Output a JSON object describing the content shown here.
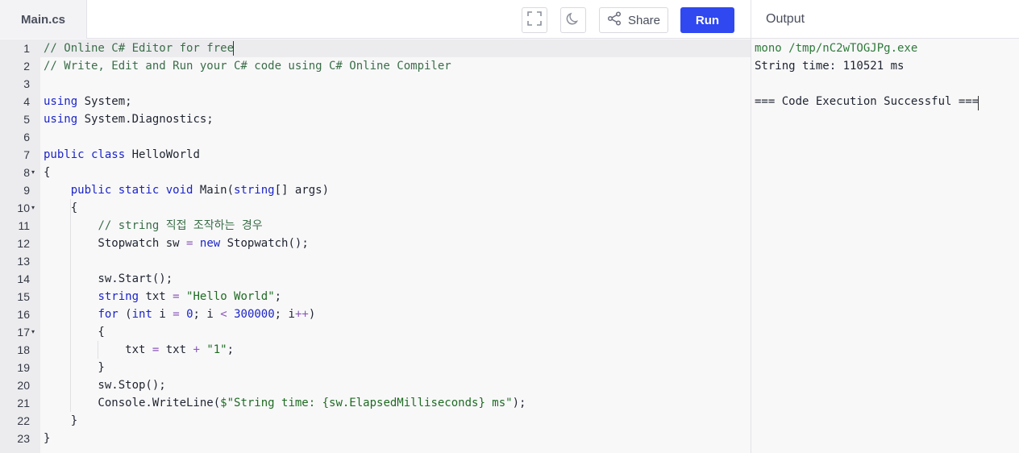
{
  "header": {
    "file_tab": "Main.cs",
    "share_label": "Share",
    "run_label": "Run",
    "output_title": "Output",
    "icons": {
      "fullscreen": "fullscreen-icon",
      "theme": "moon-icon",
      "share": "share-icon"
    }
  },
  "colors": {
    "run_button": "#2f48f0",
    "comment": "#3a6e48",
    "keyword": "#1c24c8",
    "string": "#1e6b22",
    "operator": "#8a56b8"
  },
  "editor": {
    "active_line": 1,
    "lines": [
      {
        "num": "1",
        "fold": false,
        "tokens": [
          {
            "t": "comment",
            "v": "// Online C# Editor for free"
          }
        ]
      },
      {
        "num": "2",
        "fold": false,
        "tokens": [
          {
            "t": "comment",
            "v": "// Write, Edit and Run your C# code using C# Online Compiler"
          }
        ]
      },
      {
        "num": "3",
        "fold": false,
        "tokens": []
      },
      {
        "num": "4",
        "fold": false,
        "tokens": [
          {
            "t": "keyword",
            "v": "using"
          },
          {
            "t": "plain",
            "v": " System;"
          }
        ]
      },
      {
        "num": "5",
        "fold": false,
        "tokens": [
          {
            "t": "keyword",
            "v": "using"
          },
          {
            "t": "plain",
            "v": " System.Diagnostics;"
          }
        ]
      },
      {
        "num": "6",
        "fold": false,
        "tokens": []
      },
      {
        "num": "7",
        "fold": false,
        "tokens": [
          {
            "t": "keyword",
            "v": "public class"
          },
          {
            "t": "plain",
            "v": " HelloWorld"
          }
        ]
      },
      {
        "num": "8",
        "fold": true,
        "tokens": [
          {
            "t": "plain",
            "v": "{"
          }
        ]
      },
      {
        "num": "9",
        "fold": false,
        "tokens": [
          {
            "t": "plain",
            "v": "    "
          },
          {
            "t": "keyword",
            "v": "public static void"
          },
          {
            "t": "plain",
            "v": " Main("
          },
          {
            "t": "keyword",
            "v": "string"
          },
          {
            "t": "plain",
            "v": "[] args)"
          }
        ]
      },
      {
        "num": "10",
        "fold": true,
        "tokens": [
          {
            "t": "plain",
            "v": "    {"
          }
        ]
      },
      {
        "num": "11",
        "fold": false,
        "tokens": [
          {
            "t": "plain",
            "v": "        "
          },
          {
            "t": "comment",
            "v": "// string 직접 조작하는 경우"
          }
        ]
      },
      {
        "num": "12",
        "fold": false,
        "tokens": [
          {
            "t": "plain",
            "v": "        Stopwatch sw "
          },
          {
            "t": "op",
            "v": "="
          },
          {
            "t": "plain",
            "v": " "
          },
          {
            "t": "keyword",
            "v": "new"
          },
          {
            "t": "plain",
            "v": " Stopwatch();"
          }
        ]
      },
      {
        "num": "13",
        "fold": false,
        "tokens": []
      },
      {
        "num": "14",
        "fold": false,
        "tokens": [
          {
            "t": "plain",
            "v": "        sw.Start();"
          }
        ]
      },
      {
        "num": "15",
        "fold": false,
        "tokens": [
          {
            "t": "plain",
            "v": "        "
          },
          {
            "t": "keyword",
            "v": "string"
          },
          {
            "t": "plain",
            "v": " txt "
          },
          {
            "t": "op",
            "v": "="
          },
          {
            "t": "plain",
            "v": " "
          },
          {
            "t": "string",
            "v": "\"Hello World\""
          },
          {
            "t": "plain",
            "v": ";"
          }
        ]
      },
      {
        "num": "16",
        "fold": false,
        "tokens": [
          {
            "t": "plain",
            "v": "        "
          },
          {
            "t": "keyword",
            "v": "for"
          },
          {
            "t": "plain",
            "v": " ("
          },
          {
            "t": "keyword",
            "v": "int"
          },
          {
            "t": "plain",
            "v": " i "
          },
          {
            "t": "op",
            "v": "="
          },
          {
            "t": "plain",
            "v": " "
          },
          {
            "t": "number",
            "v": "0"
          },
          {
            "t": "plain",
            "v": "; i "
          },
          {
            "t": "op",
            "v": "<"
          },
          {
            "t": "plain",
            "v": " "
          },
          {
            "t": "number",
            "v": "300000"
          },
          {
            "t": "plain",
            "v": "; i"
          },
          {
            "t": "op",
            "v": "++"
          },
          {
            "t": "plain",
            "v": ")"
          }
        ]
      },
      {
        "num": "17",
        "fold": true,
        "tokens": [
          {
            "t": "plain",
            "v": "        {"
          }
        ]
      },
      {
        "num": "18",
        "fold": false,
        "tokens": [
          {
            "t": "plain",
            "v": "            txt "
          },
          {
            "t": "op",
            "v": "="
          },
          {
            "t": "plain",
            "v": " txt "
          },
          {
            "t": "op",
            "v": "+"
          },
          {
            "t": "plain",
            "v": " "
          },
          {
            "t": "string",
            "v": "\"1\""
          },
          {
            "t": "plain",
            "v": ";"
          }
        ]
      },
      {
        "num": "19",
        "fold": false,
        "tokens": [
          {
            "t": "plain",
            "v": "        }"
          }
        ]
      },
      {
        "num": "20",
        "fold": false,
        "tokens": [
          {
            "t": "plain",
            "v": "        sw.Stop();"
          }
        ]
      },
      {
        "num": "21",
        "fold": false,
        "tokens": [
          {
            "t": "plain",
            "v": "        Console.WriteLine("
          },
          {
            "t": "string",
            "v": "$\"String time: {sw.ElapsedMilliseconds} ms\""
          },
          {
            "t": "plain",
            "v": ");"
          }
        ]
      },
      {
        "num": "22",
        "fold": false,
        "tokens": [
          {
            "t": "plain",
            "v": "    }"
          }
        ]
      },
      {
        "num": "23",
        "fold": false,
        "tokens": [
          {
            "t": "plain",
            "v": "}"
          }
        ]
      }
    ]
  },
  "output": {
    "lines": [
      {
        "kind": "cmd",
        "text": "mono /tmp/nC2wTOGJPg.exe"
      },
      {
        "kind": "text",
        "text": "String time: 110521 ms"
      },
      {
        "kind": "text",
        "text": ""
      },
      {
        "kind": "text",
        "text": "=== Code Execution Successful ==="
      }
    ]
  }
}
